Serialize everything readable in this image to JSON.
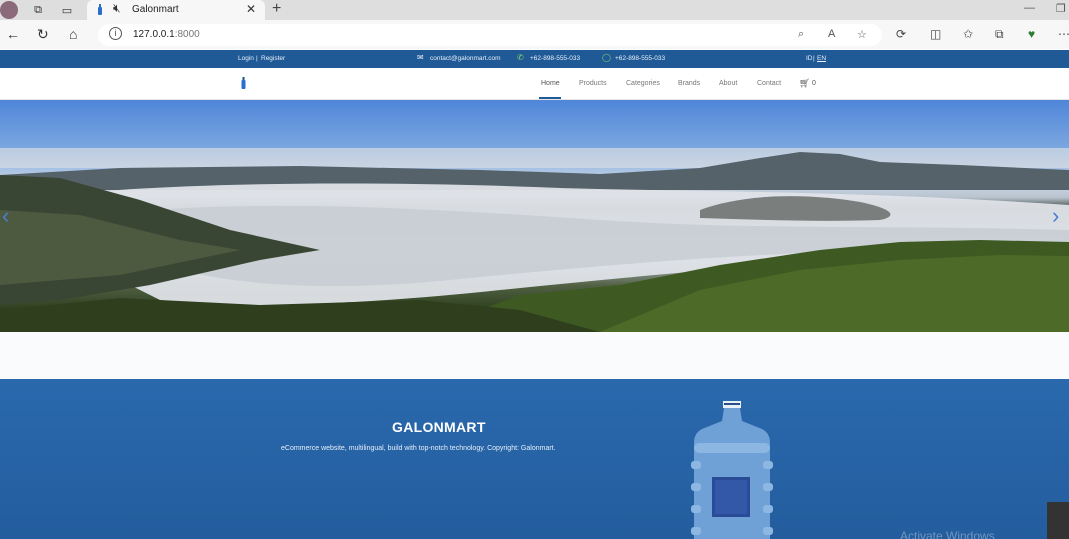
{
  "browser": {
    "tab_title": "Galonmart",
    "url_host": "127.0.0.1",
    "url_port": ":8000",
    "icons": [
      "profile-icon",
      "workspaces-icon",
      "tab-actions-icon",
      "mute-icon",
      "close-icon",
      "new-tab-icon",
      "back-icon",
      "reload-icon",
      "home-icon",
      "info-icon",
      "zoom-icon",
      "read-aloud-icon",
      "favorite-icon",
      "extensions-icon",
      "split-screen-icon",
      "favorites-icon",
      "collections-icon",
      "browser-essentials-icon",
      "more-icon"
    ]
  },
  "topbar": {
    "login": "Login",
    "separator": "|",
    "register": "Register",
    "email": "contact@galonmart.com",
    "phone": "+62-898-555-033",
    "whatsapp": "+62-898-555-033",
    "lang_id": "ID",
    "lang_sep": "|",
    "lang_en": "EN"
  },
  "nav": {
    "links": [
      "Home",
      "Products",
      "Categories",
      "Brands",
      "About",
      "Contact"
    ],
    "active": "Home",
    "cart_count": "0"
  },
  "hero": {
    "prev": "‹",
    "next": "›"
  },
  "footer": {
    "brand": "GALONMART",
    "tagline": "eCommerce website, multilingual, build with top-notch technology. Copyright: Galonmart.",
    "watermark": "Activate Windows"
  },
  "colors": {
    "brand_blue": "#1f5a96",
    "footer_blue": "#2a69ad"
  }
}
